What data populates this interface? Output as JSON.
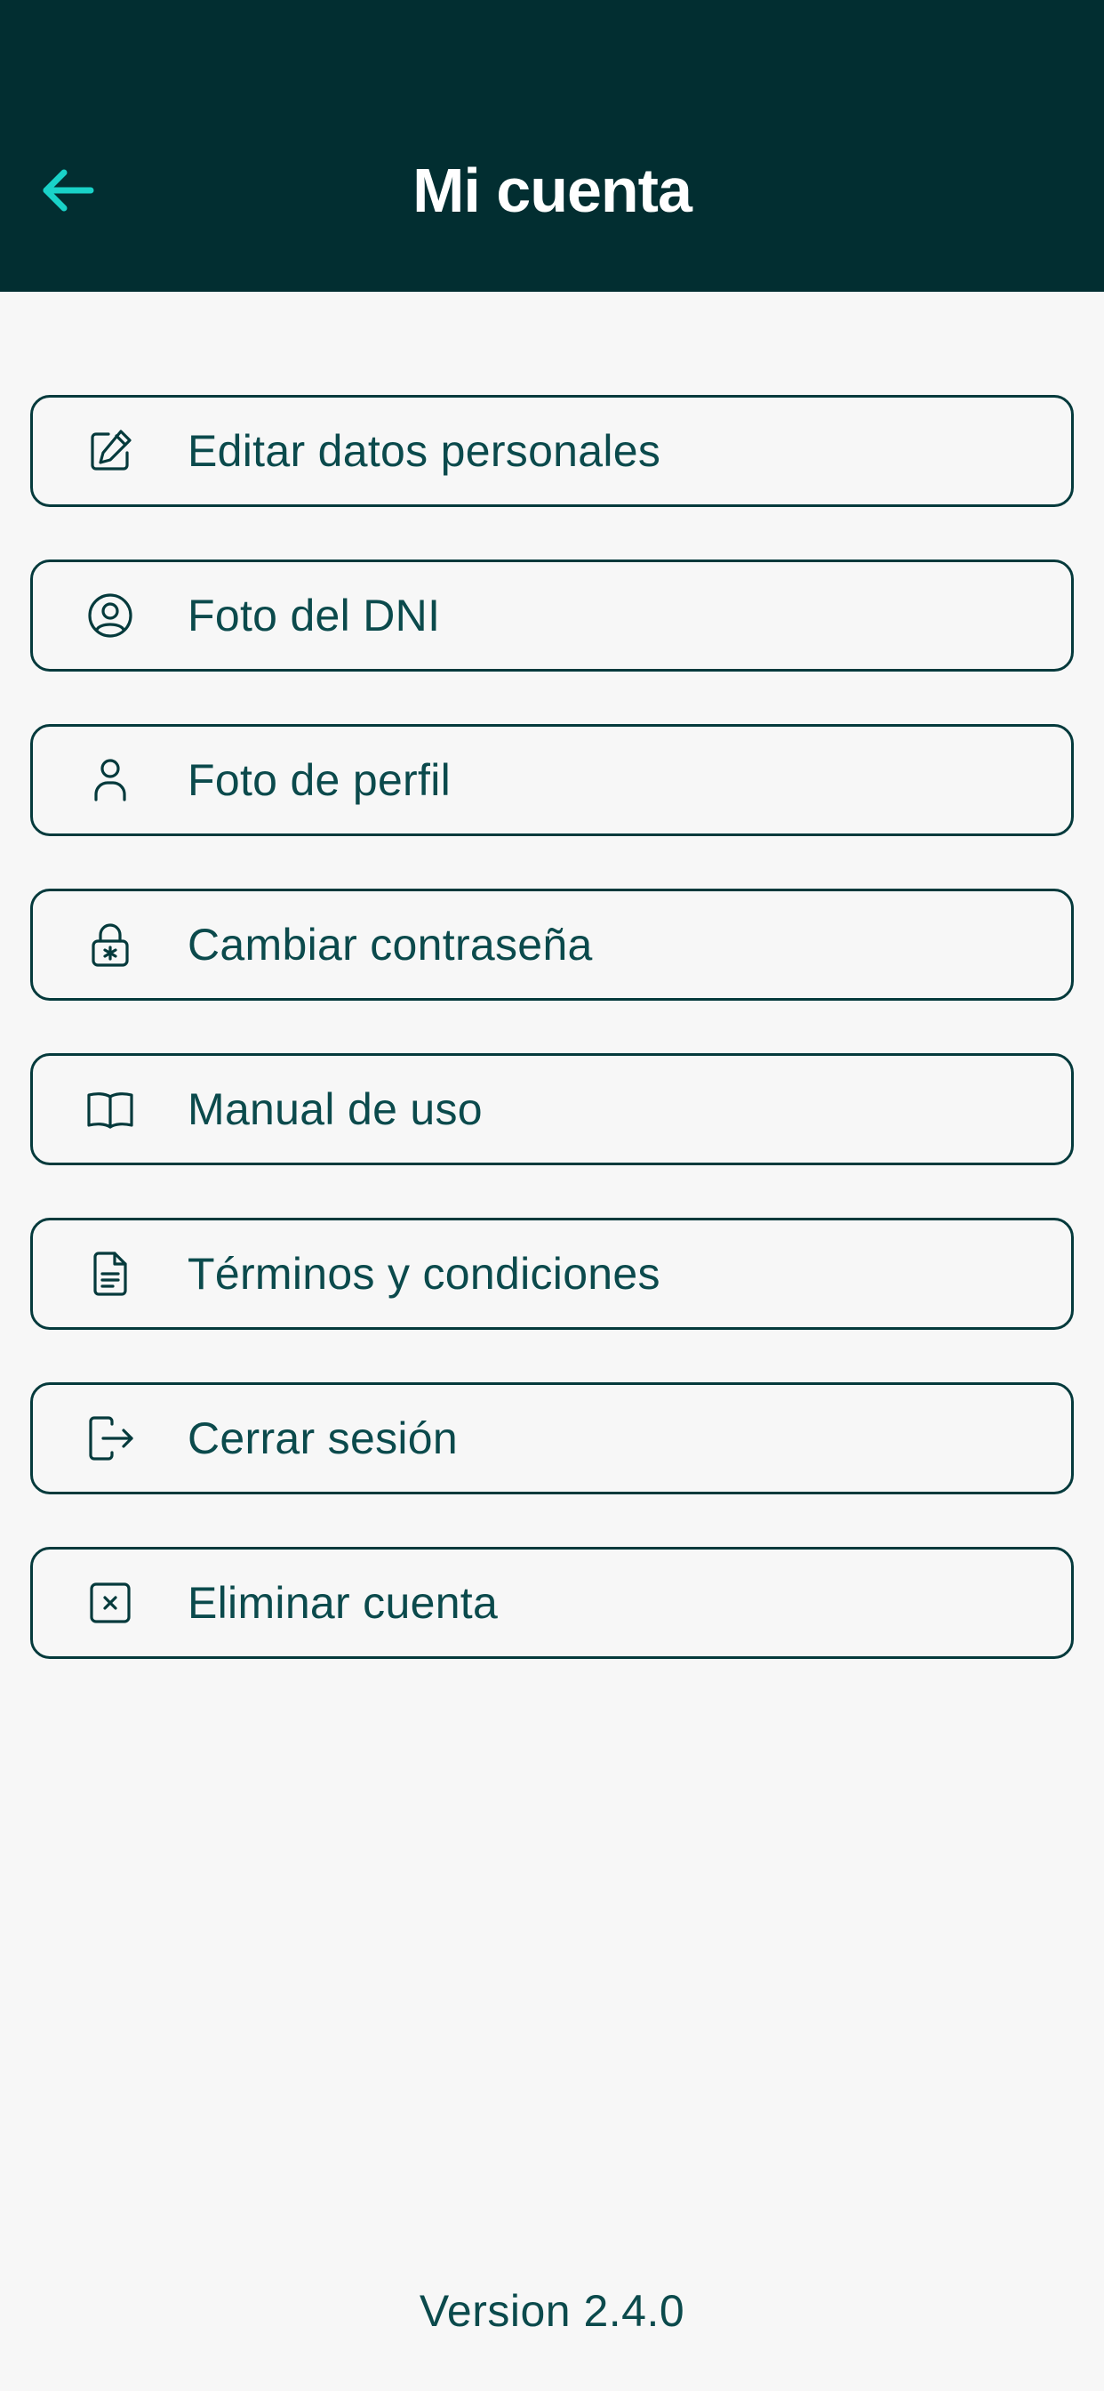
{
  "header": {
    "title": "Mi cuenta",
    "back_icon": "arrow-left-icon"
  },
  "colors": {
    "header_bg": "#022e31",
    "accent": "#19d2c8",
    "text": "#0b4a4c",
    "background": "#f7f7f7"
  },
  "menu": {
    "items": [
      {
        "label": "Editar datos personales",
        "icon": "edit-icon"
      },
      {
        "label": "Foto del DNI",
        "icon": "user-circle-icon"
      },
      {
        "label": "Foto de perfil",
        "icon": "user-icon"
      },
      {
        "label": "Cambiar contraseña",
        "icon": "lock-icon"
      },
      {
        "label": "Manual de uso",
        "icon": "book-icon"
      },
      {
        "label": "Términos y condiciones",
        "icon": "document-icon"
      },
      {
        "label": "Cerrar sesión",
        "icon": "logout-icon"
      },
      {
        "label": "Eliminar cuenta",
        "icon": "delete-box-icon"
      }
    ]
  },
  "footer": {
    "version": "Version 2.4.0"
  }
}
